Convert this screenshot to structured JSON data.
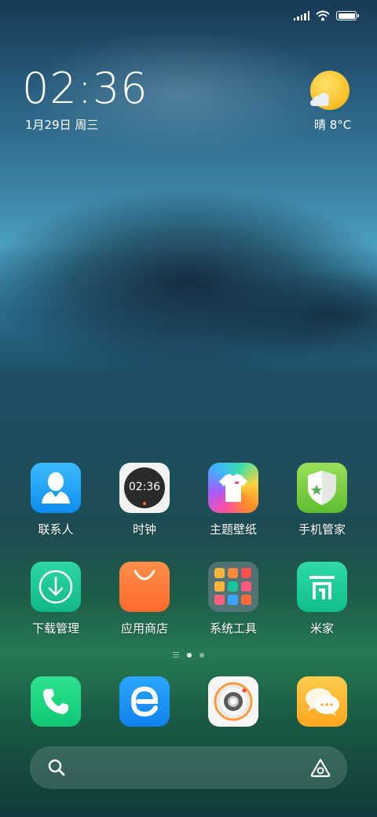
{
  "status_bar": {
    "signal_icon": "signal-icon",
    "wifi_icon": "wifi-icon",
    "battery_icon": "battery-icon"
  },
  "clock_widget": {
    "time": "02:36",
    "date": "1月29日 周三"
  },
  "weather_widget": {
    "icon": "sunny-cloud-icon",
    "text": "晴  8°C"
  },
  "apps": [
    {
      "label": "联系人",
      "icon": "contacts-icon"
    },
    {
      "label": "时钟",
      "icon": "clock-icon",
      "icon_text": "02:36"
    },
    {
      "label": "主题壁纸",
      "icon": "themes-icon"
    },
    {
      "label": "手机管家",
      "icon": "security-shield-icon"
    },
    {
      "label": "下载管理",
      "icon": "download-icon"
    },
    {
      "label": "应用商店",
      "icon": "app-store-bag-icon"
    },
    {
      "label": "系统工具",
      "icon": "tools-folder-icon"
    },
    {
      "label": "米家",
      "icon": "mijia-icon"
    }
  ],
  "page_indicator": {
    "pages": 2,
    "current": 1
  },
  "dock": [
    {
      "icon": "phone-icon"
    },
    {
      "icon": "browser-icon"
    },
    {
      "icon": "camera-icon"
    },
    {
      "icon": "messages-icon"
    }
  ],
  "search_bar": {
    "search_icon": "search-icon",
    "assistant_icon": "assistant-icon"
  },
  "colors": {
    "contacts": "#1aa0f5",
    "download": "#17c391",
    "store": "#ff7a3a",
    "mijia": "#16c89a",
    "phone": "#13d07e",
    "browser": "#1f8ff5",
    "messages": "#ffb82b",
    "security": "#7fd04a"
  }
}
